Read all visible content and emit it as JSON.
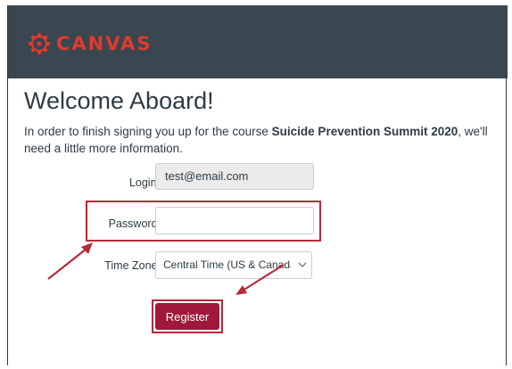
{
  "brand": {
    "name": "CANVAS",
    "color": "#e13b2d",
    "header_bg": "#3a4650"
  },
  "page": {
    "title": "Welcome Aboard!",
    "intro_prefix": "In order to finish signing you up for the course ",
    "course_name": "Suicide Prevention Summit 2020",
    "intro_suffix": ", we'll need a little more information."
  },
  "form": {
    "login_label": "Login:",
    "login_value": "test@email.com",
    "password_label": "Password:",
    "password_value": "",
    "timezone_label": "Time Zone:",
    "timezone_value": "Central Time (US & Canada) (-",
    "register_label": "Register"
  },
  "colors": {
    "annotation": "#b8283b",
    "register_button": "#a0183a",
    "text": "#2d3b45"
  },
  "icons": {
    "logo": "canvas-logo-icon",
    "select": "chevron-down-icon"
  }
}
